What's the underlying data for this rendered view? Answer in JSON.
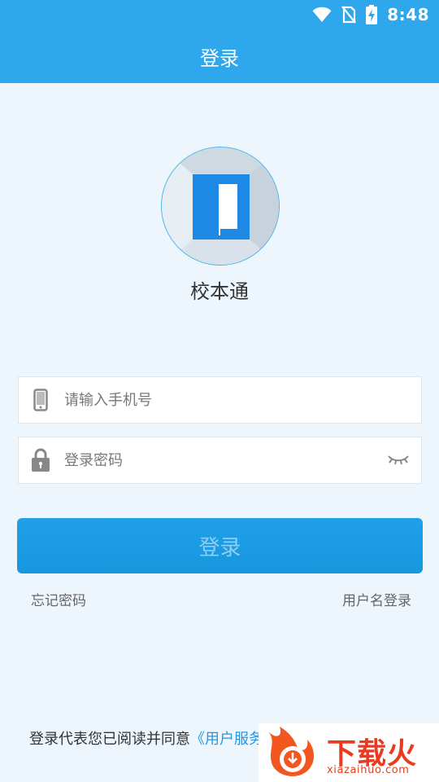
{
  "status_bar": {
    "time": "8:48",
    "icons": [
      "wifi-icon",
      "no-sim-icon",
      "battery-charging-icon"
    ]
  },
  "header": {
    "title": "登录"
  },
  "app": {
    "name": "校本通",
    "logo_icon": "door-logo-icon"
  },
  "form": {
    "phone": {
      "placeholder": "请输入手机号",
      "icon": "phone-icon"
    },
    "password": {
      "placeholder": "登录密码",
      "icon": "lock-icon",
      "toggle_icon": "eye-closed-icon"
    },
    "login_button": "登录"
  },
  "links": {
    "forgot_password": "忘记密码",
    "username_login": "用户名登录"
  },
  "agreement": {
    "prefix": "登录代表您已阅读并同意",
    "link": "《用户服务"
  },
  "watermark": {
    "text": "下载火",
    "url": "xiazaihuo.com"
  },
  "colors": {
    "primary": "#2ea7ec",
    "button": "#1a9be3",
    "background": "#eef6fd",
    "link": "#2496e3"
  }
}
